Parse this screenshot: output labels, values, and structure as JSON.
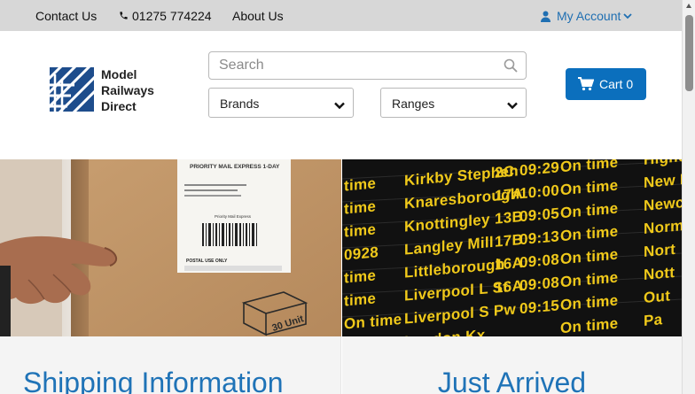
{
  "topbar": {
    "contact_label": "Contact Us",
    "phone": "01275 774224",
    "about_label": "About Us",
    "account_label": "My Account"
  },
  "header": {
    "logo_lines": [
      "Model",
      "Railways",
      "Direct"
    ],
    "search": {
      "placeholder": "Search",
      "value": ""
    },
    "brands_label": "Brands",
    "ranges_label": "Ranges",
    "cart_label": "Cart",
    "cart_count": "0"
  },
  "banners": {
    "left": {
      "image": "parcel-box-photo",
      "label_text": [
        "PRIORITY MAIL EXPRESS 1-DAY",
        "Priority Mail Express",
        "POSTAL USE ONLY"
      ],
      "box_print": "30 Unit"
    },
    "right": {
      "image": "departure-board-photo",
      "board_rows": [
        {
          "dest": "Kirkby Stephen",
          "plat": "2C",
          "time": "09:29",
          "status": "On time"
        },
        {
          "dest": "Knaresborough",
          "plat": "17A",
          "time": "10:00",
          "status": "On time"
        },
        {
          "dest": "Knottingley",
          "plat": "13B",
          "time": "09:05",
          "status": "On time"
        },
        {
          "dest": "Langley Mill",
          "plat": "17B",
          "time": "09:13",
          "status": "On time"
        },
        {
          "dest": "Littleborough",
          "plat": "16A",
          "time": "09:08",
          "status": "On time"
        },
        {
          "dest": "Liverpool L St",
          "plat": "16A",
          "time": "09:08",
          "status": "On time"
        },
        {
          "dest": "Liverpool S Pw",
          "plat": "",
          "time": "09:15",
          "status": "On time"
        },
        {
          "dest": "Loudon Kx",
          "plat": "",
          "time": "",
          "status": "On time"
        }
      ],
      "side_left": [
        "time",
        "time",
        "time",
        "0928",
        "time",
        "time",
        "On time",
        "On time"
      ],
      "side_right": [
        "Higher",
        "New Pu",
        "Newca",
        "Norma",
        "Nort",
        "Nott",
        "Out",
        "Pa"
      ]
    }
  },
  "panels": {
    "left_title": "Shipping Information",
    "right_title": "Just Arrived"
  },
  "colors": {
    "brand_blue": "#0b6fbd",
    "link_blue": "#1f6fb2",
    "topbar_bg": "#d7d7d7",
    "board_yellow": "#f0c91a"
  }
}
